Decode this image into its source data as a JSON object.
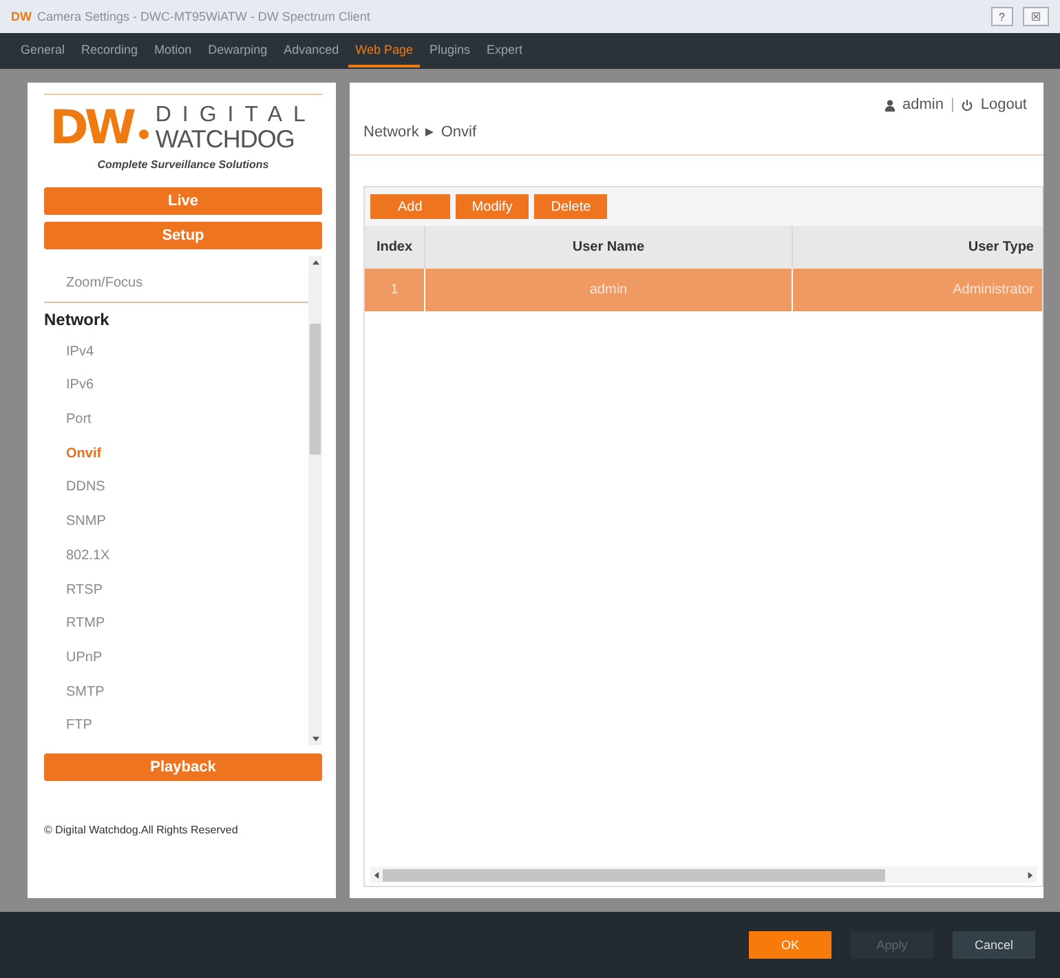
{
  "window": {
    "app_mark": "DW",
    "title": "Camera Settings - DWC-MT95WiATW - DW Spectrum Client",
    "controls": [
      "?",
      "☒"
    ]
  },
  "tabs": [
    {
      "label": "General",
      "selected": false
    },
    {
      "label": "Recording",
      "selected": false
    },
    {
      "label": "Motion",
      "selected": false
    },
    {
      "label": "Dewarping",
      "selected": false
    },
    {
      "label": "Advanced",
      "selected": false
    },
    {
      "label": "Web Page",
      "selected": true
    },
    {
      "label": "Plugins",
      "selected": false
    },
    {
      "label": "Expert",
      "selected": false
    }
  ],
  "sidebar": {
    "logo": {
      "brand_mark": "DW",
      "line_1": "DIGITAL",
      "line_2": "WATCHDOG",
      "tagline": "Complete Surveillance Solutions"
    },
    "top_buttons": [
      "Live",
      "Setup"
    ],
    "items": [
      {
        "label": "Zoom/Focus",
        "kind": "item",
        "selected": false
      },
      {
        "label": "Network",
        "kind": "group"
      },
      {
        "label": "IPv4",
        "kind": "item",
        "selected": false
      },
      {
        "label": "IPv6",
        "kind": "item",
        "selected": false
      },
      {
        "label": "Port",
        "kind": "item",
        "selected": false
      },
      {
        "label": "Onvif",
        "kind": "item",
        "selected": true
      },
      {
        "label": "DDNS",
        "kind": "item",
        "selected": false
      },
      {
        "label": "SNMP",
        "kind": "item",
        "selected": false
      },
      {
        "label": "802.1X",
        "kind": "item",
        "selected": false
      },
      {
        "label": "RTSP",
        "kind": "item",
        "selected": false
      },
      {
        "label": "RTMP",
        "kind": "item",
        "selected": false
      },
      {
        "label": "UPnP",
        "kind": "item",
        "selected": false
      },
      {
        "label": "SMTP",
        "kind": "item",
        "selected": false
      },
      {
        "label": "FTP",
        "kind": "item",
        "selected": false
      }
    ],
    "bottom_button": "Playback",
    "copyright": "© Digital Watchdog.All Rights Reserved"
  },
  "header": {
    "user": "admin",
    "separator": "|",
    "logout": "Logout"
  },
  "breadcrumb": [
    "Network",
    "Onvif"
  ],
  "toolbar": [
    "Add",
    "Modify",
    "Delete"
  ],
  "table": {
    "columns": [
      "Index",
      "User Name",
      "User Type"
    ],
    "rows": [
      {
        "cells": [
          "1",
          "admin",
          "Administrator"
        ],
        "selected": true
      }
    ]
  },
  "footer_buttons": [
    {
      "label": "OK",
      "kind": "primary",
      "disabled": false
    },
    {
      "label": "Apply",
      "kind": "normal",
      "disabled": true
    },
    {
      "label": "Cancel",
      "kind": "normal",
      "disabled": false
    }
  ]
}
